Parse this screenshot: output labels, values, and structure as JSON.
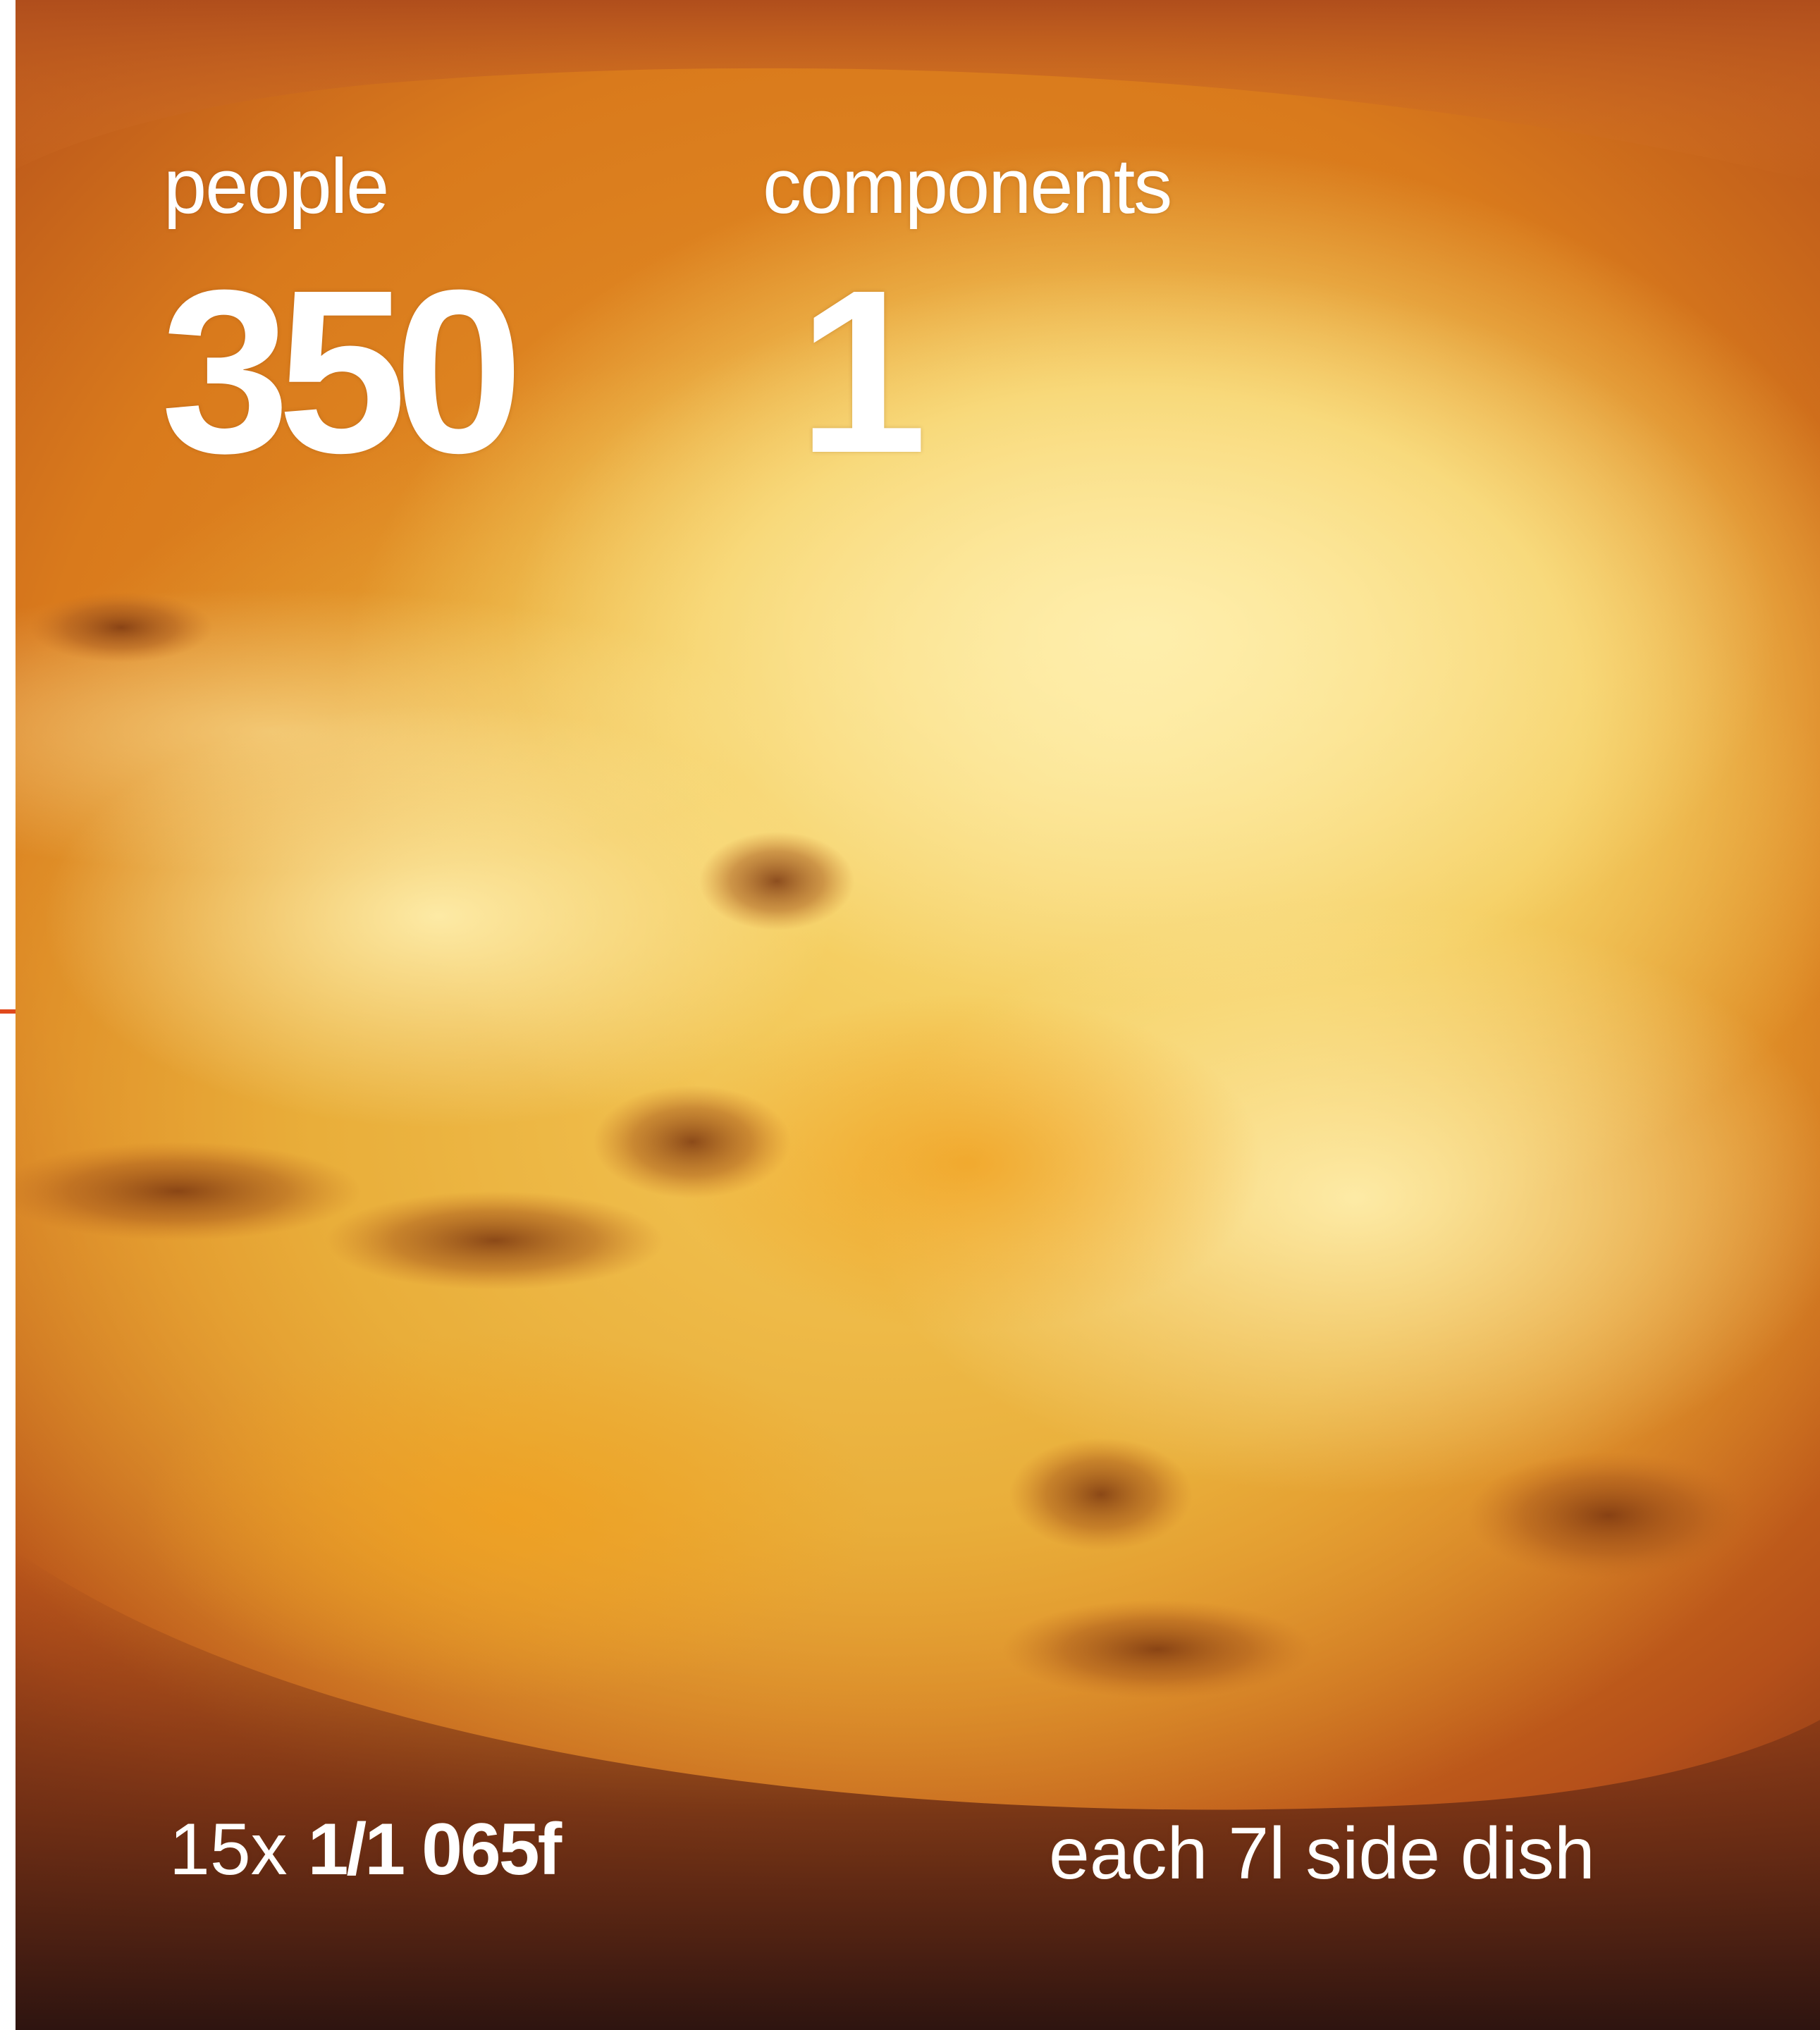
{
  "stats": {
    "people_label": "people",
    "people_value": "350",
    "components_label": "components",
    "components_value": "1"
  },
  "footer": {
    "quantity": "15x",
    "container": "1/1 065f",
    "description": "each 7l side dish"
  },
  "colors": {
    "accent_tick": "#e0491c",
    "text": "#ffffff"
  }
}
